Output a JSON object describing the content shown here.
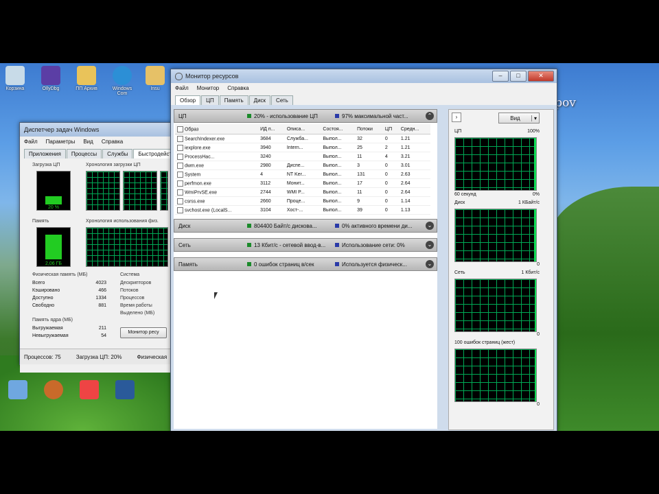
{
  "watermark": "Nikolay Potupov",
  "desktop_icons": [
    {
      "label": "Корзина"
    },
    {
      "label": "OllyDbg"
    },
    {
      "label": "ПП Архив"
    },
    {
      "label": "Windows Com"
    },
    {
      "label": "Insu"
    },
    {
      "label": ""
    },
    {
      "label": ""
    },
    {
      "label": ""
    },
    {
      "label": ""
    }
  ],
  "task_manager": {
    "title": "Диспетчер задач Windows",
    "menu": [
      "Файл",
      "Параметры",
      "Вид",
      "Справка"
    ],
    "tabs": [
      "Приложения",
      "Процессы",
      "Службы",
      "Быстродействие"
    ],
    "cpu_label": "Загрузка ЦП",
    "cpu_value": "20 %",
    "cpu_history_label": "Хронология загрузки ЦП",
    "mem_label": "Память",
    "mem_value": "2,06 ГБ",
    "mem_history_label": "Хронология использования физ.",
    "phys_mem_label": "Физическая память (МБ)",
    "phys_rows": [
      {
        "k": "Всего",
        "v": "4023"
      },
      {
        "k": "Кэшировано",
        "v": "466"
      },
      {
        "k": "Доступно",
        "v": "1334"
      },
      {
        "k": "Свободно",
        "v": "881"
      }
    ],
    "system_label": "Система",
    "system_rows": [
      "Дескрипторов",
      "Потоков",
      "Процессов",
      "Время работы",
      "Выделено (МБ)"
    ],
    "kernel_mem_label": "Память ядра (МБ)",
    "kernel_rows": [
      {
        "k": "Выгружаемая",
        "v": "211"
      },
      {
        "k": "Невыгружаемая",
        "v": "54"
      }
    ],
    "resmon_button": "Монитор ресу",
    "status": [
      "Процессов: 75",
      "Загрузка ЦП: 20%",
      "Физическая"
    ]
  },
  "resource_monitor": {
    "title": "Монитор ресурсов",
    "menu": [
      "Файл",
      "Монитор",
      "Справка"
    ],
    "tabs": [
      "Обзор",
      "ЦП",
      "Память",
      "Диск",
      "Сеть"
    ],
    "cpu_section": {
      "name": "ЦП",
      "info1": "20% - использование ЦП",
      "info2": "97% максимальной част..."
    },
    "columns": [
      "Образ",
      "ИД п...",
      "Описа...",
      "Состоя...",
      "Потоки",
      "ЦП",
      "Средн..."
    ],
    "rows": [
      [
        "SearchIndexer.exe",
        "3684",
        "Служба...",
        "Выпол...",
        "32",
        "0",
        "1.21"
      ],
      [
        "iexplore.exe",
        "3940",
        "Intern...",
        "Выпол...",
        "25",
        "2",
        "1.21"
      ],
      [
        "ProcessHac...",
        "3240",
        "",
        "Выпол...",
        "11",
        "4",
        "3.21"
      ],
      [
        "dwm.exe",
        "2980",
        "Диспе...",
        "Выпол...",
        "3",
        "0",
        "3.01"
      ],
      [
        "System",
        "4",
        "NT Ker...",
        "Выпол...",
        "131",
        "0",
        "2.63"
      ],
      [
        "perfmon.exe",
        "3112",
        "Монит...",
        "Выпол...",
        "17",
        "0",
        "2.64"
      ],
      [
        "WmiPrvSE.exe",
        "2744",
        "WMI P...",
        "Выпол...",
        "11",
        "0",
        "2.64"
      ],
      [
        "csrss.exe",
        "2660",
        "Проце...",
        "Выпол...",
        "9",
        "0",
        "1.14"
      ],
      [
        "svchost.exe (LocalS...",
        "3104",
        "Хост-...",
        "Выпол...",
        "39",
        "0",
        "1.13"
      ]
    ],
    "disk_section": {
      "name": "Диск",
      "info1": "804400 Байт/с дискова...",
      "info2": "0% активного времени ди..."
    },
    "net_section": {
      "name": "Сеть",
      "info1": "13 Кбит/с - сетевой ввод-в...",
      "info2": "Использование сети: 0%"
    },
    "mem_section": {
      "name": "Память",
      "info1": "0 ошибок страниц в/сек",
      "info2": "Используется физическ..."
    },
    "view_button": "Вид",
    "graphs": [
      {
        "label": "ЦП",
        "max": "100%",
        "min_left": "60 секунд",
        "min_right": "0%"
      },
      {
        "label": "Диск",
        "max": "1 КБайт/с",
        "min_left": "",
        "min_right": "0"
      },
      {
        "label": "Сеть",
        "max": "1 Кбит/с",
        "min_left": "",
        "min_right": "0"
      },
      {
        "label": "100 ошибок страниц (жест)",
        "max": "",
        "min_left": "",
        "min_right": "0"
      }
    ]
  }
}
